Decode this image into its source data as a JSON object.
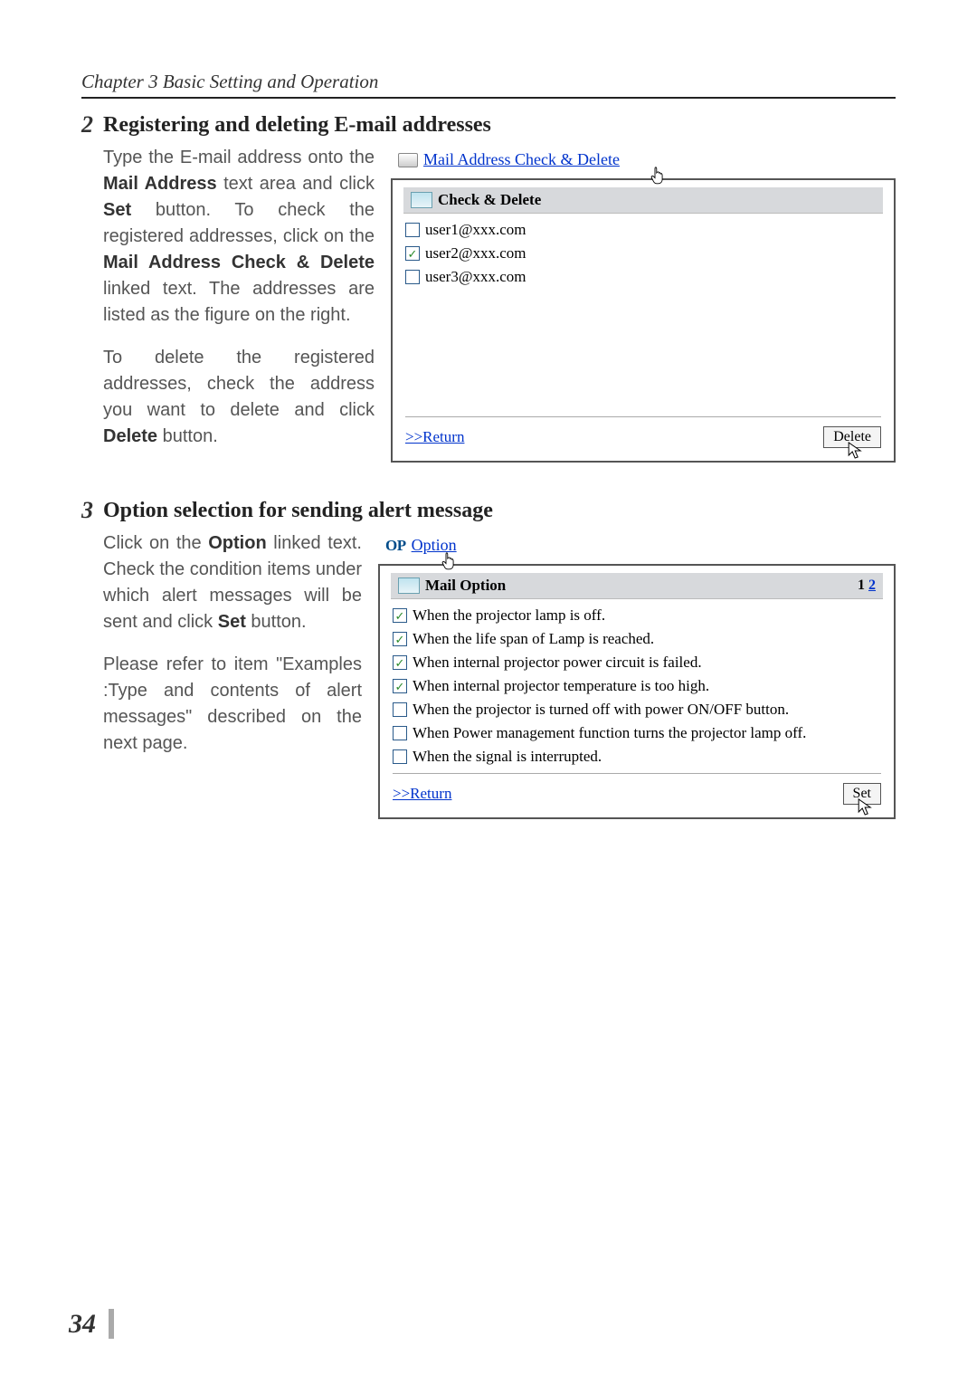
{
  "chapter": "Chapter 3 Basic Setting and Operation",
  "page_number": "34",
  "sec2": {
    "num": "2",
    "title": "Registering and deleting E-mail addresses",
    "para1_a": "Type the E-mail address onto the ",
    "para1_b": "Mail Address",
    "para1_c": " text area and click ",
    "para1_d": "Set",
    "para1_e": " button. To check the registered addresses, click on the ",
    "para1_f": "Mail Address Check & Delete",
    "para1_g": " linked text. The addresses are listed as the figure on the right.",
    "para2_a": "To delete the registered addresses, check the address you want to delete and click ",
    "para2_b": "Delete",
    "para2_c": " button."
  },
  "sec2_shot": {
    "link_text": "Mail Address Check & Delete",
    "panel_title": "Check & Delete",
    "rows": [
      {
        "checked": false,
        "email": "user1@xxx.com"
      },
      {
        "checked": true,
        "email": "user2@xxx.com"
      },
      {
        "checked": false,
        "email": "user3@xxx.com"
      }
    ],
    "return": ">>Return",
    "button": "Delete"
  },
  "sec3": {
    "num": "3",
    "title": "Option selection for sending alert message",
    "para1_a": "Click on the ",
    "para1_b": "Option",
    "para1_c": " linked text. Check the condition items under which alert messages will be sent and click ",
    "para1_d": "Set",
    "para1_e": " button.",
    "para2": "Please refer to item \"Examples :Type and contents of alert messages\" described on the next page."
  },
  "sec3_shot": {
    "op_label": "OP",
    "link_text": "Option",
    "panel_title": "Mail Option",
    "page_current": "1",
    "page_link": "2",
    "rows": [
      {
        "checked": true,
        "text": "When the projector lamp is off."
      },
      {
        "checked": true,
        "text": "When the life span of Lamp is reached."
      },
      {
        "checked": true,
        "text": "When internal projector power circuit is failed."
      },
      {
        "checked": true,
        "text": "When internal projector temperature is too high."
      },
      {
        "checked": false,
        "text": "When the projector is turned off with power ON/OFF button."
      },
      {
        "checked": false,
        "text": "When Power management function turns the projector lamp off."
      },
      {
        "checked": false,
        "text": "When the signal is interrupted."
      }
    ],
    "return": ">>Return",
    "button": "Set"
  }
}
